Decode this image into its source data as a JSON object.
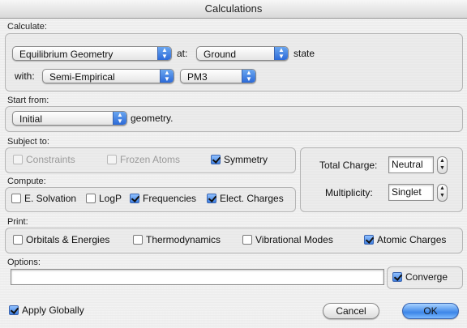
{
  "window": {
    "title": "Calculations"
  },
  "calculate": {
    "label": "Calculate:",
    "method": "Equilibrium Geometry",
    "at_label": "at:",
    "state": "Ground",
    "state_label": "state",
    "with_label": "with:",
    "model": "Semi-Empirical",
    "basis": "PM3"
  },
  "start_from": {
    "label": "Start from:",
    "value": "Initial",
    "suffix": "geometry."
  },
  "subject_to": {
    "label": "Subject to:",
    "constraints": {
      "label": "Constraints",
      "checked": false,
      "enabled": false
    },
    "frozen_atoms": {
      "label": "Frozen Atoms",
      "checked": false,
      "enabled": false
    },
    "symmetry": {
      "label": "Symmetry",
      "checked": true,
      "enabled": true
    }
  },
  "charge": {
    "total_charge_label": "Total Charge:",
    "total_charge_value": "Neutral",
    "multiplicity_label": "Multiplicity:",
    "multiplicity_value": "Singlet"
  },
  "compute": {
    "label": "Compute:",
    "e_solvation": {
      "label": "E. Solvation",
      "checked": false
    },
    "logp": {
      "label": "LogP",
      "checked": false
    },
    "frequencies": {
      "label": "Frequencies",
      "checked": true
    },
    "elect_charges": {
      "label": "Elect. Charges",
      "checked": true
    }
  },
  "print": {
    "label": "Print:",
    "orbitals": {
      "label": "Orbitals & Energies",
      "checked": false
    },
    "thermo": {
      "label": "Thermodynamics",
      "checked": false
    },
    "vib_modes": {
      "label": "Vibrational Modes",
      "checked": false
    },
    "atomic_charges": {
      "label": "Atomic Charges",
      "checked": true
    }
  },
  "options": {
    "label": "Options:",
    "value": "",
    "converge": {
      "label": "Converge",
      "checked": true
    }
  },
  "footer": {
    "apply_globally": {
      "label": "Apply Globally",
      "checked": true
    },
    "cancel_label": "Cancel",
    "ok_label": "OK"
  }
}
